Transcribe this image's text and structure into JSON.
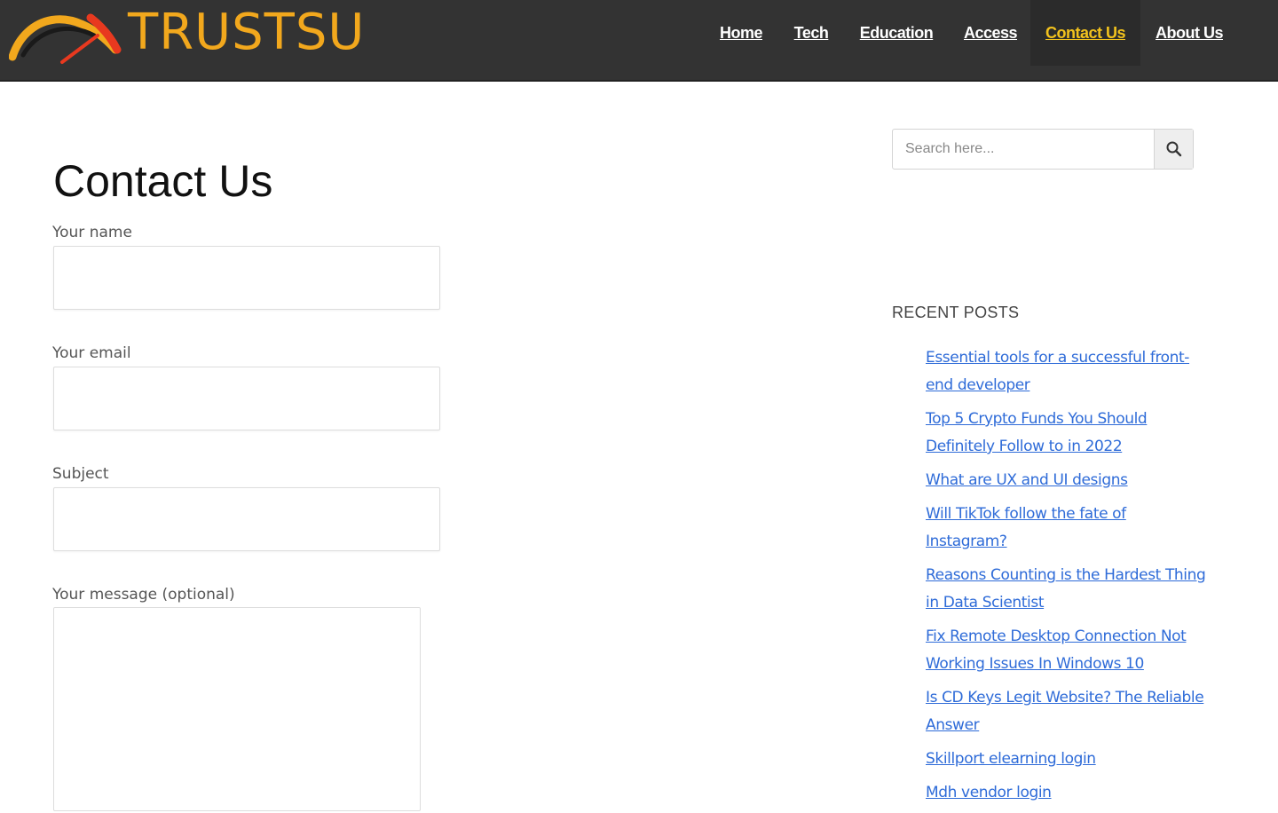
{
  "site": {
    "logo_text": "TRUSTSU",
    "brand_color": "#f2a81d",
    "header_bg": "#333333",
    "active_nav_color": "#f2c21d",
    "link_color": "#2e6bd8"
  },
  "nav": {
    "items": [
      {
        "label": "Home",
        "active": false
      },
      {
        "label": "Tech",
        "active": false
      },
      {
        "label": "Education",
        "active": false
      },
      {
        "label": "Access",
        "active": false
      },
      {
        "label": "Contact Us",
        "active": true
      },
      {
        "label": "About Us",
        "active": false
      }
    ]
  },
  "page": {
    "title": "Contact Us"
  },
  "form": {
    "name_label": "Your name",
    "name_value": "",
    "email_label": "Your email",
    "email_value": "",
    "subject_label": "Subject",
    "subject_value": "",
    "message_label": "Your message (optional)",
    "message_value": ""
  },
  "search": {
    "placeholder": "Search here...",
    "value": "",
    "button_icon": "search-icon"
  },
  "recent_posts": {
    "title": "RECENT POSTS",
    "items": [
      {
        "label": "Essential tools for a successful front-end developer"
      },
      {
        "label": "Top 5 Crypto Funds You Should Definitely Follow to in 2022"
      },
      {
        "label": "What are UX and UI designs"
      },
      {
        "label": "Will TikTok follow the fate of Instagram?"
      },
      {
        "label": "Reasons Counting is the Hardest Thing in Data Scientist"
      },
      {
        "label": "Fix Remote Desktop Connection Not Working Issues In Windows 10"
      },
      {
        "label": "Is CD Keys Legit Website? The Reliable Answer"
      },
      {
        "label": "Skillport elearning login"
      },
      {
        "label": "Mdh vendor login"
      }
    ]
  }
}
